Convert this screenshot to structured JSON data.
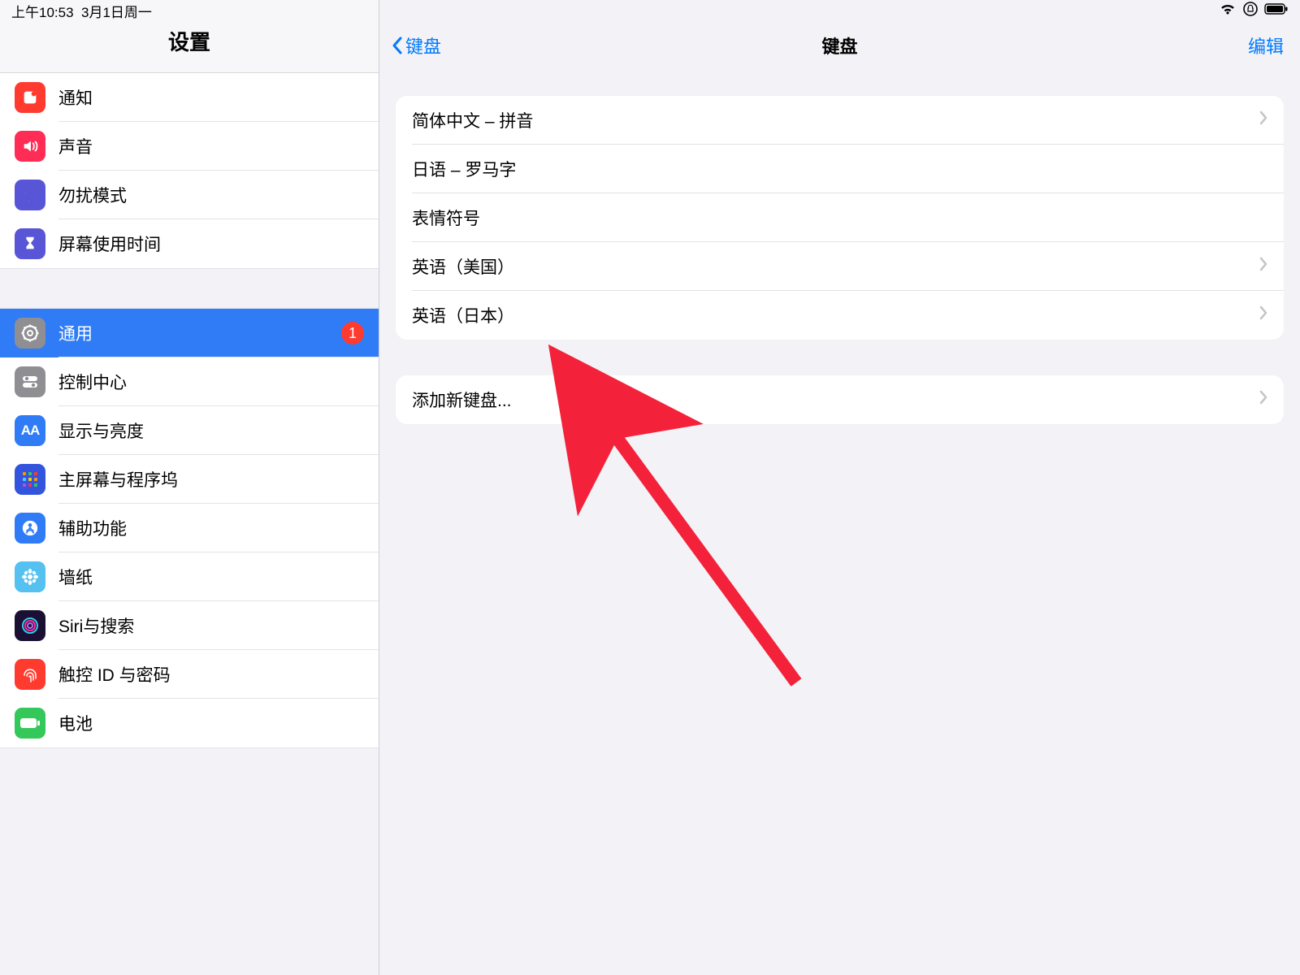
{
  "statusbar": {
    "time": "上午10:53",
    "date": "3月1日周一"
  },
  "sidebar": {
    "title": "设置",
    "groups": [
      {
        "items": [
          {
            "key": "notifications",
            "label": "通知",
            "iconBg": "#ff3b30",
            "iconSvg": "bell"
          },
          {
            "key": "sounds",
            "label": "声音",
            "iconBg": "#ff2d55",
            "iconSvg": "speaker"
          },
          {
            "key": "dnd",
            "label": "勿扰模式",
            "iconBg": "#5856d6",
            "iconSvg": "moon"
          },
          {
            "key": "screentime",
            "label": "屏幕使用时间",
            "iconBg": "#5856d6",
            "iconSvg": "hourglass"
          }
        ]
      },
      {
        "items": [
          {
            "key": "general",
            "label": "通用",
            "iconBg": "#8e8e93",
            "iconSvg": "gear",
            "selected": true,
            "badge": "1"
          },
          {
            "key": "control",
            "label": "控制中心",
            "iconBg": "#8e8e93",
            "iconSvg": "toggles"
          },
          {
            "key": "display",
            "label": "显示与亮度",
            "iconBg": "#2f7cf6",
            "iconSvg": "aa"
          },
          {
            "key": "home",
            "label": "主屏幕与程序坞",
            "iconBg": "#3355dd",
            "iconSvg": "grid"
          },
          {
            "key": "accessibility",
            "label": "辅助功能",
            "iconBg": "#2f7cf6",
            "iconSvg": "person"
          },
          {
            "key": "wallpaper",
            "label": "墙纸",
            "iconBg": "#54c1f0",
            "iconSvg": "flower"
          },
          {
            "key": "siri",
            "label": "Siri与搜索",
            "iconBg": "#1a1034",
            "iconSvg": "siri"
          },
          {
            "key": "touchid",
            "label": "触控 ID 与密码",
            "iconBg": "#ff3b30",
            "iconSvg": "finger"
          },
          {
            "key": "battery",
            "label": "电池",
            "iconBg": "#34c759",
            "iconSvg": "battery"
          }
        ]
      }
    ]
  },
  "detail": {
    "back": "键盘",
    "title": "键盘",
    "edit": "编辑",
    "keyboards": [
      {
        "label": "简体中文 – 拼音",
        "chevron": true
      },
      {
        "label": "日语 – 罗马字",
        "chevron": false
      },
      {
        "label": "表情符号",
        "chevron": false
      },
      {
        "label": "英语（美国）",
        "chevron": true
      },
      {
        "label": "英语（日本）",
        "chevron": true
      }
    ],
    "add": {
      "label": "添加新键盘...",
      "chevron": true
    }
  },
  "colors": {
    "accent": "#007aff",
    "red": "#ff3b30"
  }
}
